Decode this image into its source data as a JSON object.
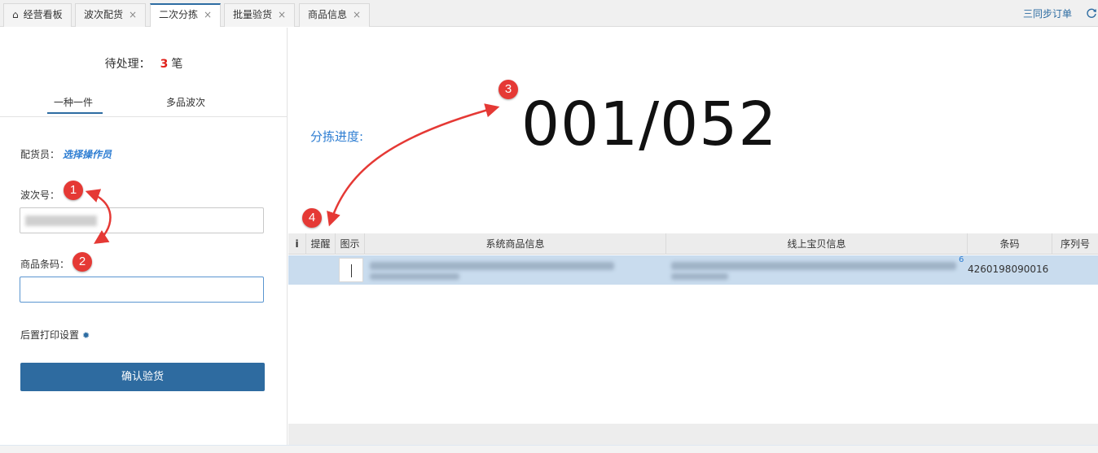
{
  "tabs": [
    {
      "label": "经营看板",
      "closable": false,
      "home": true,
      "active": false
    },
    {
      "label": "波次配货",
      "closable": true,
      "active": false
    },
    {
      "label": "二次分拣",
      "closable": true,
      "active": true
    },
    {
      "label": "批量验货",
      "closable": true,
      "active": false
    },
    {
      "label": "商品信息",
      "closable": true,
      "active": false
    }
  ],
  "toolbar": {
    "sync_orders": "三同步订单",
    "refresh_icon": "refresh-icon",
    "close_glyph": "×"
  },
  "left": {
    "pending_label": "待处理：",
    "pending_count": "3",
    "pending_unit": "笔",
    "mode_tabs": [
      "一种一件",
      "多品波次"
    ],
    "operator_label": "配货员：",
    "operator_link": "选择操作员",
    "wave_label": "波次号：",
    "wave_value": "",
    "barcode_label": "商品条码：",
    "barcode_value": "",
    "print_settings_label": "后置打印设置",
    "confirm_button": "确认验货"
  },
  "progress": {
    "label": "分拣进度:",
    "value": "001/052"
  },
  "grid": {
    "columns": [
      "i",
      "提醒",
      "图示",
      "系统商品信息",
      "线上宝贝信息",
      "条码",
      "序列号"
    ],
    "rows": [
      {
        "barcode": "4260198090016",
        "tag": "6"
      }
    ]
  },
  "annotations": [
    "1",
    "2",
    "3",
    "4"
  ],
  "colors": {
    "accent": "#2d6ca2",
    "link": "#2d7dd2",
    "alert": "#e53935",
    "row_selected": "#c9dcee"
  }
}
